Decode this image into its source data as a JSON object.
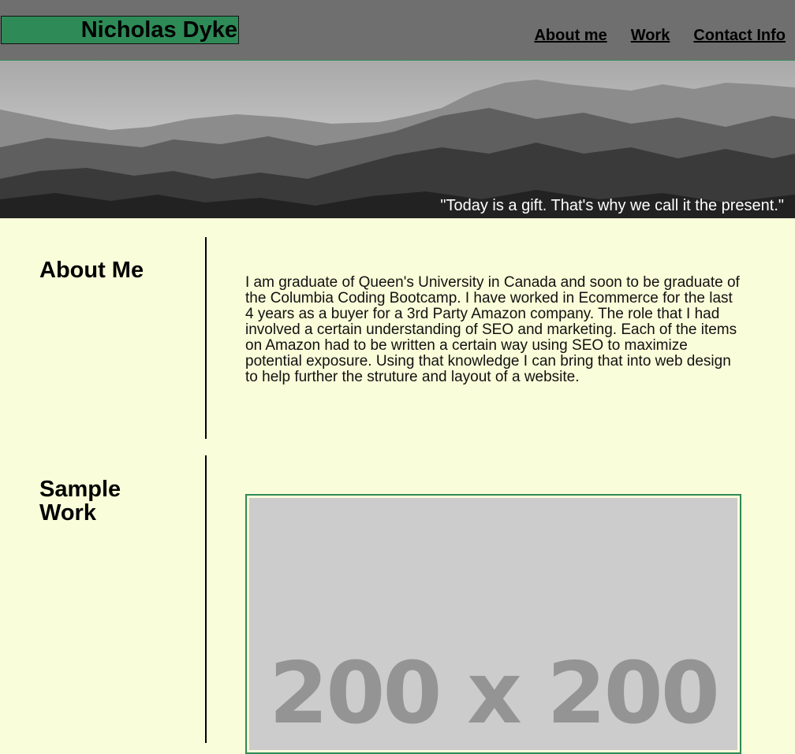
{
  "header": {
    "brand": "Nicholas Dyke",
    "nav": [
      {
        "label": "About me"
      },
      {
        "label": "Work"
      },
      {
        "label": "Contact Info"
      }
    ]
  },
  "hero": {
    "quote": "\"Today is a gift. That's why we call it the present.\""
  },
  "about": {
    "title": "About Me",
    "text": "I am graduate of Queen's University in Canada and soon to be graduate of the Columbia Coding Bootcamp. I have worked in Ecommerce for the last 4 years as a buyer for a 3rd Party Amazon company. The role that I had involved a certain understanding of SEO and marketing. Each of the items on Amazon had to be written a certain way using SEO to maximize potential exposure. Using that knowledge I can bring that into web design to help further the struture and layout of a website."
  },
  "work": {
    "title": "Sample Work",
    "placeholder_text": "200 x 200"
  },
  "colors": {
    "page_background": "#fafdd9",
    "header_background": "#6f6f6f",
    "accent": "#2e8b57"
  }
}
